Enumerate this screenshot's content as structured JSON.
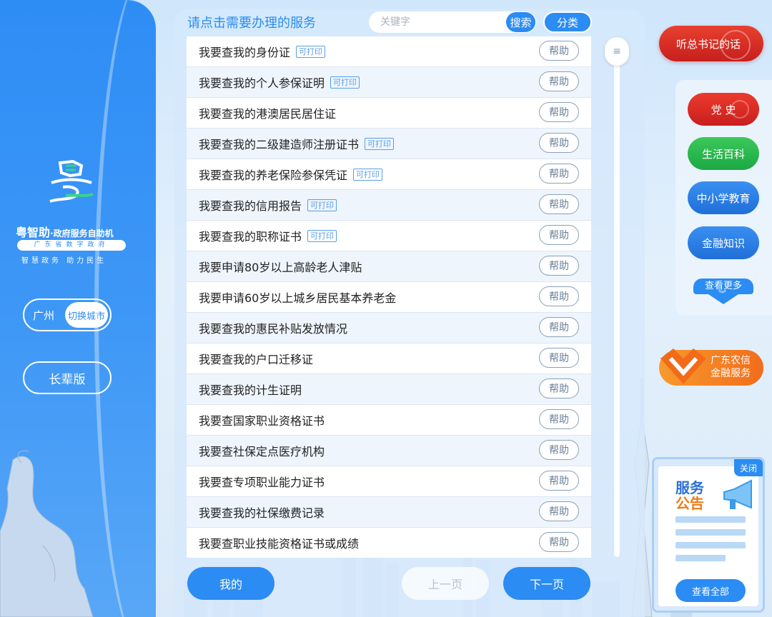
{
  "brand": {
    "name": "粤智助",
    "subtitle": "·政府服务自助机",
    "org": "广东省数字政府",
    "slogan": "智慧政务 助力民生"
  },
  "city": {
    "current": "广州",
    "switch_label": "切换城市"
  },
  "elder_mode_label": "长辈版",
  "header": {
    "title": "请点击需要办理的服务",
    "search_placeholder": "关键字",
    "search_label": "搜索",
    "category_label": "分类"
  },
  "print_tag": "可打印",
  "help_label": "帮助",
  "services": [
    {
      "label": "我要查我的身份证",
      "printable": true
    },
    {
      "label": "我要查我的个人参保证明",
      "printable": true
    },
    {
      "label": "我要查我的港澳居民居住证",
      "printable": false
    },
    {
      "label": "我要查我的二级建造师注册证书",
      "printable": true
    },
    {
      "label": "我要查我的养老保险参保凭证",
      "printable": true
    },
    {
      "label": "我要查我的信用报告",
      "printable": true
    },
    {
      "label": "我要查我的职称证书",
      "printable": true
    },
    {
      "label": "我要申请80岁以上高龄老人津贴",
      "printable": false
    },
    {
      "label": "我要申请60岁以上城乡居民基本养老金",
      "printable": false
    },
    {
      "label": "我要查我的惠民补贴发放情况",
      "printable": false
    },
    {
      "label": "我要查我的户口迁移证",
      "printable": false
    },
    {
      "label": "我要查我的计生证明",
      "printable": false
    },
    {
      "label": "我要查国家职业资格证书",
      "printable": false
    },
    {
      "label": "我要查社保定点医疗机构",
      "printable": false
    },
    {
      "label": "我要查专项职业能力证书",
      "printable": false
    },
    {
      "label": "我要查我的社保缴费记录",
      "printable": false
    },
    {
      "label": "我要查职业技能资格证书或成绩",
      "printable": false
    }
  ],
  "pager": {
    "mine": "我的",
    "prev": "上一页",
    "next": "下一页"
  },
  "right": {
    "speech": "听总书记的话",
    "categories": [
      "党 史",
      "生活百科",
      "中小学教育",
      "金融知识"
    ],
    "more": "查看更多",
    "bank_line1": "广东农信",
    "bank_line2": "金融服务"
  },
  "notice": {
    "close": "关闭",
    "title_line1": "服务",
    "title_line2": "公告",
    "view_all": "查看全部"
  },
  "colors": {
    "primary": "#2b8cf3",
    "party_red": "#e0302a",
    "green": "#2bb94f",
    "orange": "#f5851f"
  }
}
